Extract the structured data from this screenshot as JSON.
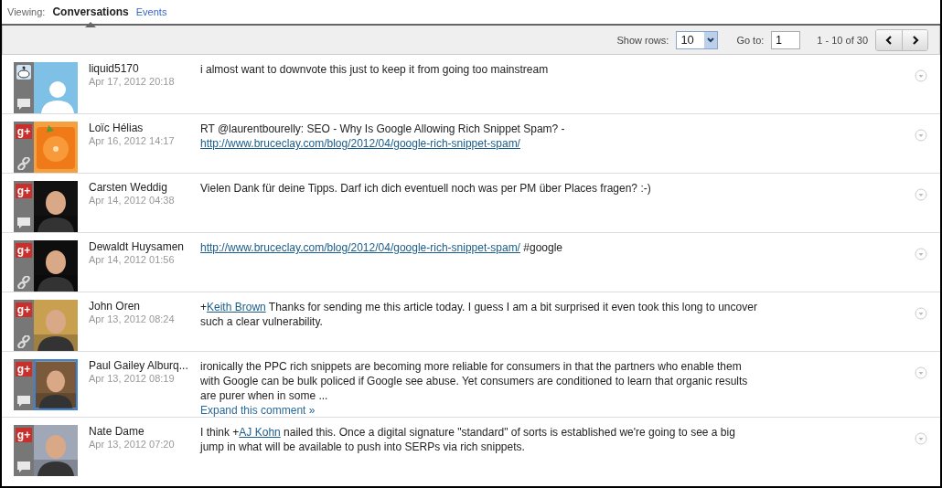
{
  "viewing": {
    "label": "Viewing:",
    "tabs": [
      {
        "label": "Conversations",
        "selected": true
      },
      {
        "label": "Events",
        "selected": false
      }
    ]
  },
  "toolbar": {
    "rows_label": "Show rows:",
    "rows_value": "10",
    "goto_label": "Go to:",
    "goto_value": "1",
    "range": "1 - 10 of 30"
  },
  "rows": [
    {
      "source": {
        "kind": "reddit"
      },
      "attachment": {
        "kind": "comment"
      },
      "avatar": {
        "kind": "placeholder"
      },
      "selected": false,
      "name": "liquid5170",
      "date": "Apr 17, 2012 20:18",
      "parts": [
        {
          "kind": "text",
          "text": "i almost want to downvote this just to keep it from going too mainstream"
        }
      ]
    },
    {
      "source": {
        "kind": "gplus",
        "label": "g+"
      },
      "attachment": {
        "kind": "link"
      },
      "avatar": {
        "kind": "picture"
      },
      "selected": false,
      "name": "Loïc Hélias",
      "date": "Apr 16, 2012 14:17",
      "parts": [
        {
          "kind": "text",
          "text": "RT @laurentbourelly: SEO - Why Is Google Allowing Rich Snippet Spam? - "
        },
        {
          "kind": "link",
          "text": "http://www.bruceclay.com/blog/2012/04/google-rich-snippet-spam/"
        }
      ]
    },
    {
      "source": {
        "kind": "gplus",
        "label": "g+"
      },
      "attachment": {
        "kind": "comment"
      },
      "avatar": {
        "kind": "picture"
      },
      "selected": false,
      "name": "Carsten Weddig",
      "date": "Apr 14, 2012 04:38",
      "parts": [
        {
          "kind": "text",
          "text": "Vielen Dank für deine Tipps. Darf ich dich eventuell noch was per PM über Places fragen? :-)"
        }
      ]
    },
    {
      "source": {
        "kind": "gplus",
        "label": "g+"
      },
      "attachment": {
        "kind": "link"
      },
      "avatar": {
        "kind": "picture"
      },
      "selected": false,
      "name": "Dewaldt Huysamen",
      "date": "Apr 14, 2012 01:56",
      "parts": [
        {
          "kind": "link",
          "text": "http://www.bruceclay.com/blog/2012/04/google-rich-snippet-spam/"
        },
        {
          "kind": "text",
          "text": " #google"
        }
      ]
    },
    {
      "source": {
        "kind": "gplus",
        "label": "g+"
      },
      "attachment": {
        "kind": "link"
      },
      "avatar": {
        "kind": "picture"
      },
      "selected": false,
      "name": "John Oren",
      "date": "Apr 13, 2012 08:24",
      "parts": [
        {
          "kind": "text",
          "text": "+"
        },
        {
          "kind": "link",
          "text": "Keith Brown"
        },
        {
          "kind": "text",
          "text": " Thanks for sending me this article today. I guess I am a bit surprised it even took this long to uncover such a clear vulnerability."
        }
      ]
    },
    {
      "source": {
        "kind": "gplus",
        "label": "g+"
      },
      "attachment": {
        "kind": "comment"
      },
      "avatar": {
        "kind": "picture"
      },
      "selected": true,
      "name": "Paul Gailey Alburq...",
      "date": "Apr 13, 2012 08:19",
      "parts": [
        {
          "kind": "text",
          "text": "ironically the PPC rich snippets are becoming more reliable for consumers in that the partners who enable them with Google can be bulk policed if Google see abuse. Yet consumers are conditioned to learn that organic results are purer when in some ..."
        }
      ],
      "expand": "Expand this comment »"
    },
    {
      "source": {
        "kind": "gplus",
        "label": "g+"
      },
      "attachment": {
        "kind": "comment"
      },
      "avatar": {
        "kind": "picture"
      },
      "selected": false,
      "name": "Nate Dame",
      "date": "Apr 13, 2012 07:20",
      "parts": [
        {
          "kind": "text",
          "text": "I think +"
        },
        {
          "kind": "link",
          "text": "AJ Kohn"
        },
        {
          "kind": "text",
          "text": " nailed this. Once a digital signature \"standard\" of sorts is established we're going to see a big jump in what will be available to push into SERPs via rich snippets."
        }
      ]
    }
  ]
}
